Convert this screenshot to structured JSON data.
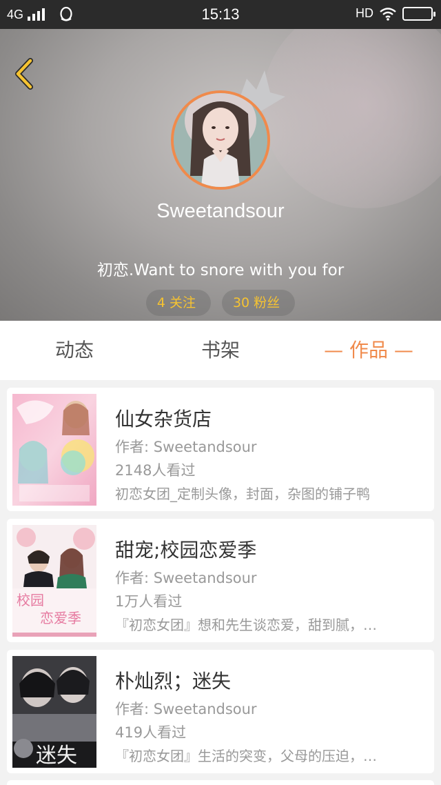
{
  "status_bar": {
    "network": "4G",
    "time": "15:13",
    "hd_label": "HD",
    "icons": [
      "signal-icon",
      "qq-icon",
      "wifi-icon",
      "battery-icon"
    ]
  },
  "profile": {
    "back_icon": "chevron-left-icon",
    "username": "Sweetandsour",
    "bio": "初恋.Want to snore with you for",
    "following": {
      "count": "4",
      "label": "关注"
    },
    "followers": {
      "count": "30",
      "label": "粉丝"
    }
  },
  "tabs": [
    {
      "label": "动态",
      "active": false
    },
    {
      "label": "书架",
      "active": false
    },
    {
      "label": "— 作品 —",
      "active": true
    }
  ],
  "works": [
    {
      "title": "仙女杂货店",
      "author": "作者: Sweetandsour",
      "views": "2148人看过",
      "description": "初恋女团_定制头像，封面，杂图的铺子鸭"
    },
    {
      "title": "甜宠;校园恋爱季",
      "author": "作者: Sweetandsour",
      "views": "1万人看过",
      "description": "『初恋女团』想和先生谈恋爱，甜到腻，…"
    },
    {
      "title": "朴灿烈；迷失",
      "author": "作者: Sweetandsour",
      "views": "419人看过",
      "description": "『初恋女团』生活的突变，父母的压迫，…"
    }
  ],
  "colors": {
    "accent": "#f08a4b",
    "pill_text": "#f6c331",
    "status_bar_bg": "#2b2b2b",
    "back_icon": "#f6c331"
  }
}
